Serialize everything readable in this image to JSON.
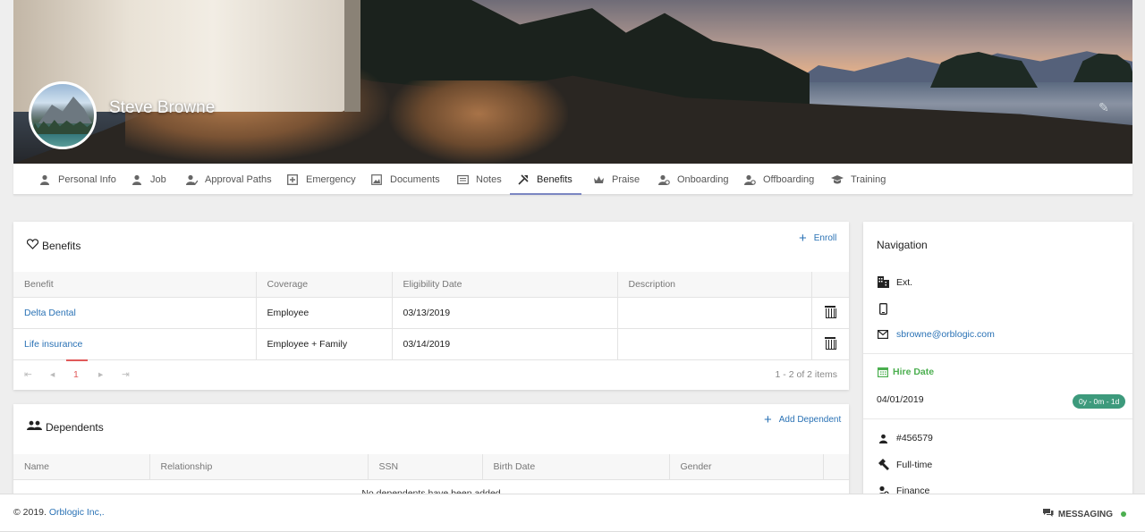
{
  "profile": {
    "name": "Steve Browne"
  },
  "tabs": [
    {
      "label": "Personal Info",
      "icon": "person-icon"
    },
    {
      "label": "Job",
      "icon": "person-icon"
    },
    {
      "label": "Approval Paths",
      "icon": "person-check-icon"
    },
    {
      "label": "Emergency",
      "icon": "plus-box-icon"
    },
    {
      "label": "Documents",
      "icon": "image-icon"
    },
    {
      "label": "Notes",
      "icon": "notes-icon"
    },
    {
      "label": "Benefits",
      "icon": "tools-icon",
      "active": true
    },
    {
      "label": "Praise",
      "icon": "crown-icon"
    },
    {
      "label": "Onboarding",
      "icon": "person-gear-icon"
    },
    {
      "label": "Offboarding",
      "icon": "person-gear-icon"
    },
    {
      "label": "Training",
      "icon": "graduation-cap-icon"
    }
  ],
  "benefits": {
    "title": "Benefits",
    "enroll_label": "Enroll",
    "columns": [
      "Benefit",
      "Coverage",
      "Eligibility Date",
      "Description"
    ],
    "rows": [
      {
        "benefit": "Delta Dental",
        "coverage": "Employee",
        "eligibility": "03/13/2019",
        "description": ""
      },
      {
        "benefit": "Life insurance",
        "coverage": "Employee + Family",
        "eligibility": "03/14/2019",
        "description": ""
      }
    ],
    "pager": {
      "current_page": "1",
      "summary": "1 - 2 of 2 items"
    }
  },
  "dependents": {
    "title": "Dependents",
    "add_label": "Add Dependent",
    "columns": [
      "Name",
      "Relationship",
      "SSN",
      "Birth Date",
      "Gender"
    ],
    "empty_text": "No dependents have been added"
  },
  "navigation": {
    "title": "Navigation",
    "ext_label": "Ext.",
    "email": "sbrowne@orblogic.com",
    "hire_date_label": "Hire Date",
    "hire_date": "04/01/2019",
    "tenure_badge": "0y - 0m - 1d",
    "employee_id": "#456579",
    "employment_type": "Full-time",
    "department": "Finance",
    "accent_color": "#4caf50"
  },
  "footer": {
    "copyright_prefix": "© 2019.",
    "company_link": "Orblogic Inc,.",
    "messaging_label": "MESSAGING",
    "status_color": "#4caf50"
  }
}
